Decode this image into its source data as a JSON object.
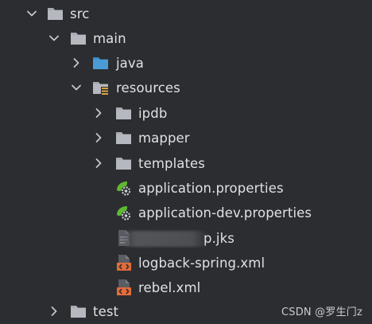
{
  "tree": {
    "src": {
      "label": "src",
      "expanded": true
    },
    "main": {
      "label": "main",
      "expanded": true
    },
    "java": {
      "label": "java",
      "expanded": false
    },
    "resources": {
      "label": "resources",
      "expanded": true
    },
    "ipdb": {
      "label": "ipdb",
      "expanded": false
    },
    "mapper": {
      "label": "mapper",
      "expanded": false
    },
    "templates": {
      "label": "templates",
      "expanded": false
    },
    "application_properties": {
      "label": "application.properties",
      "icon": "spring-properties-icon"
    },
    "application_dev_properties": {
      "label": "application-dev.properties",
      "icon": "spring-properties-icon"
    },
    "jks_file": {
      "label": "p.jks",
      "icon": "generic-file-icon"
    },
    "logback_spring_xml": {
      "label": "logback-spring.xml",
      "icon": "xml-file-icon"
    },
    "rebel_xml": {
      "label": "rebel.xml",
      "icon": "xml-file-icon"
    },
    "test": {
      "label": "test",
      "expanded": false
    }
  },
  "watermark": {
    "text": "CSDN @罗生门z"
  },
  "colors": {
    "background": "#2b2d30",
    "text": "#dfe1e5",
    "chevron": "#c4c6cb",
    "folder": "#a9adb3",
    "source_folder": "#4a9cd6",
    "spring_green": "#5fb832",
    "xml_orange": "#e36b3a"
  }
}
